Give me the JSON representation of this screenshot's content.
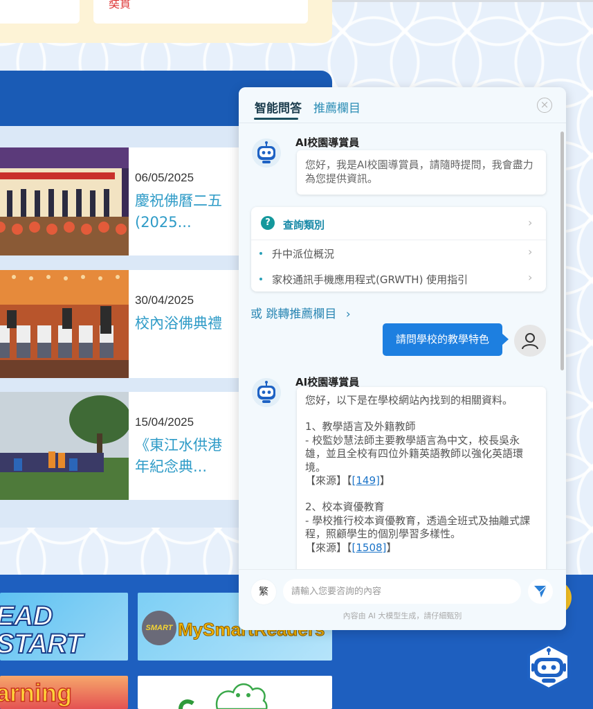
{
  "top_card": {
    "partial_text": "奘貫"
  },
  "news": {
    "items": [
      {
        "date": "06/05/2025",
        "title": "慶祝佛曆二五\n(2025..."
      },
      {
        "date": "30/04/2025",
        "title": "校內浴佛典禮"
      },
      {
        "date": "15/04/2025",
        "title": "《東江水供港\n年紀念典..."
      }
    ]
  },
  "banners": {
    "b1": "EAD START",
    "b2": "MySmartReaders",
    "b2_logo": "SMART",
    "b3": "arning"
  },
  "chat": {
    "tabs": {
      "active": "智能問答",
      "inactive": "推薦欄目"
    },
    "close": "×",
    "bot_name": "AI校園導賞員",
    "greeting": "您好，我是AI校園導賞員，請隨時提問，我會盡力為您提供資訊。",
    "query_card": {
      "header": "查詢類別",
      "header_icon": "?",
      "items": [
        {
          "label": "升中派位概況"
        },
        {
          "label": "家校通訊手機應用程式(GRWTH) 使用指引"
        }
      ]
    },
    "jump_link": "或 跳轉推薦欄目",
    "user_message": "請問學校的教學特色",
    "answer": {
      "intro": "您好，以下是在學校網站內找到的相關資料。",
      "s1_title": "1、教學語言及外籍教師",
      "s1_body": "- 校監妙慧法師主要教學語言為中文，校長吳永雄，並且全校有四位外籍英語教師以強化英語環境。",
      "s1_source": "【來源】【",
      "s1_ref": "[149]",
      "s2_title": "2、校本資優教育",
      "s2_body": "- 學校推行校本資優教育，透過全班式及抽離式課程，照顧學生的個別學習多樣性。",
      "s2_source": "【來源】【",
      "s2_ref": "[1508]",
      "bracket_close": "】"
    },
    "lang_toggle": "繁",
    "input_placeholder": "請輸入您要咨詢的內容",
    "footer_note": "內容由 AI 大模型生成，請仔細甄別"
  },
  "colors": {
    "primary_blue": "#1a5bb5",
    "accent_teal": "#2e9bc7",
    "user_bubble": "#1d7fe0"
  }
}
